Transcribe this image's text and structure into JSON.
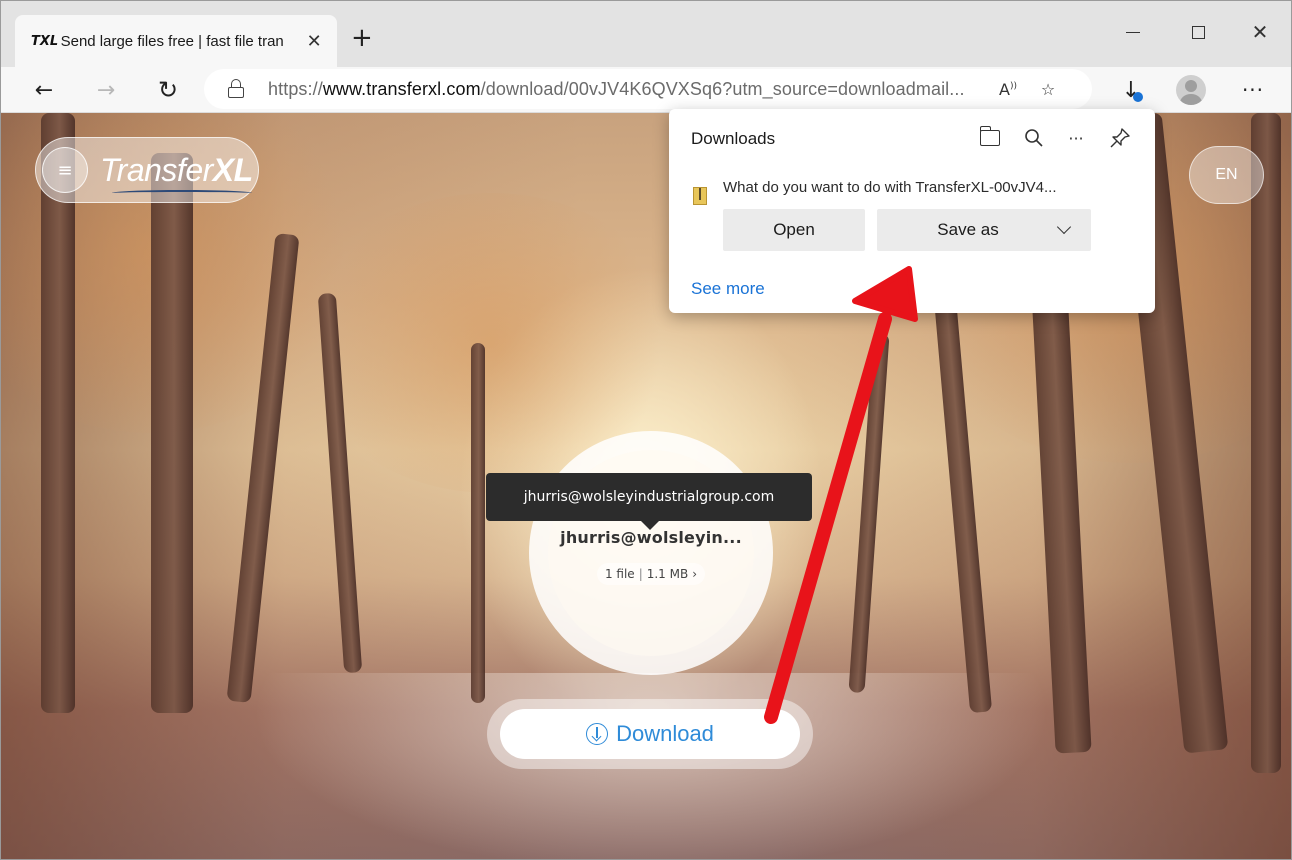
{
  "browser": {
    "tab": {
      "favicon_text": "TXL",
      "title": "Send large files free | fast file tran",
      "close_glyph": "✕"
    },
    "new_tab_glyph": "+",
    "window_controls": {
      "close_glyph": "✕"
    },
    "nav": {
      "back_glyph": "←",
      "forward_glyph": "→",
      "reload_glyph": "↻"
    },
    "address": {
      "scheme": "https://",
      "host": "www.transferxl.com",
      "path": "/download/00vJV4K6QVXSq6?utm_source=downloadmail..."
    },
    "address_icons": {
      "read_aloud_glyph": "A",
      "favorites_glyph": "☆"
    },
    "toolbar_icons": {
      "download_glyph": "↓",
      "more_glyph": "···"
    }
  },
  "page": {
    "logo": {
      "prefix": "Transfer",
      "suffix": "XL",
      "menu_glyph": "≡"
    },
    "language": "EN",
    "tooltip": "jhurris@wolsleyindustrialgroup.com",
    "sender": "jhurris@wolsleyin...",
    "file_count": "1 file",
    "file_size": "1.1 MB",
    "file_info_chevron": "›",
    "download_label": "Download"
  },
  "downloads_panel": {
    "title": "Downloads",
    "icons": {
      "search_glyph": "⚲",
      "more_glyph": "···",
      "pin_glyph": "⚲"
    },
    "question": "What do you want to do with TransferXL-00vJV4...",
    "open_label": "Open",
    "save_as_label": "Save as",
    "see_more": "See more"
  },
  "colors": {
    "link_blue": "#1a73d6",
    "download_blue": "#2f8bd8",
    "annotation_red": "#e8131a"
  }
}
